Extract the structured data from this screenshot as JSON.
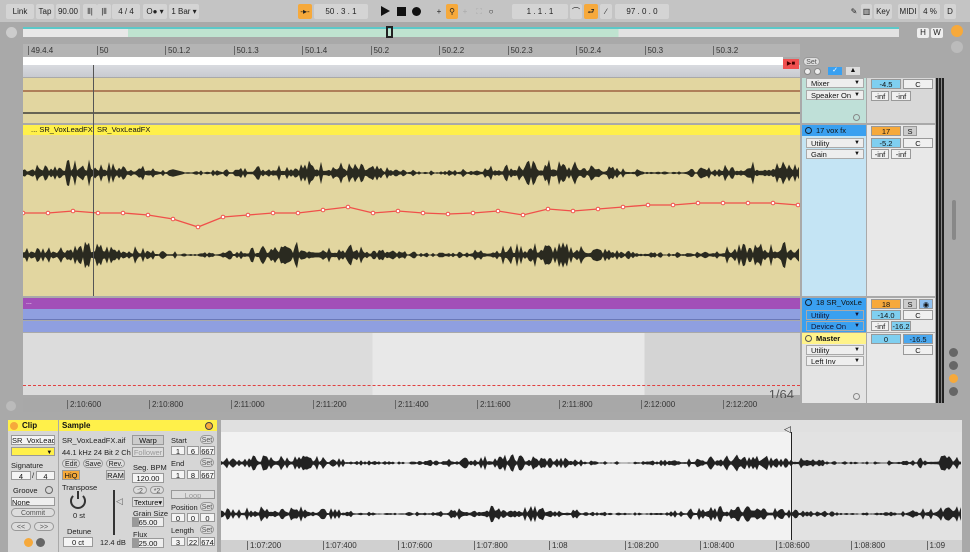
{
  "toolbar": {
    "link": "Link",
    "tap": "Tap",
    "tempo": "90.00",
    "nudge_down": "⦀|",
    "nudge_up": "|⦀",
    "sig_num": "4",
    "sig_sep": "/",
    "sig_den": "4",
    "metronome": "O●",
    "quantize": "1 Bar",
    "position": "50 .  3 .  1",
    "loop_start": "1 .  1 .  1",
    "loop_length": "97 .  0 .  0",
    "key": "Key",
    "midi": "MIDI",
    "cpu": "4 %",
    "d": "D"
  },
  "overview": {
    "h": "H",
    "w": "W"
  },
  "ruler": {
    "labels": [
      "49.4.4",
      "50",
      "50.1.2",
      "50.1.3",
      "50.1.4",
      "50.2",
      "50.2.2",
      "50.2.3",
      "50.2.4",
      "50.3",
      "50.3.2"
    ],
    "set": "Set"
  },
  "tracks": {
    "t1": {
      "device": "Mixer",
      "device2": "Speaker On",
      "vol": "-4.5",
      "pan": "C",
      "peak_l": "-inf",
      "peak_r": "-inf"
    },
    "t17": {
      "name": "17 vox fx",
      "clip_prev": "... SR_VoxLeadFX",
      "clip": "SR_VoxLeadFX",
      "num": "17",
      "solo": "S",
      "dev1": "Utility",
      "dev2": "Gain",
      "vol": "-5.2",
      "pan": "C",
      "peak_l": "-inf",
      "peak_r": "-inf"
    },
    "t18": {
      "name": "18 SR_VoxLe",
      "clip": "...",
      "num": "18",
      "solo": "S",
      "dev1": "Utility",
      "dev2": "Device On",
      "vol": "-14.0",
      "pan": "C",
      "peak_l": "-inf",
      "peak_r": "-16.2"
    },
    "master": {
      "name": "Master",
      "dev1": "Utility",
      "dev2": "Left Inv",
      "vol": "0",
      "vol2": "-16.5",
      "pan": "C",
      "zoom": "1/64"
    }
  },
  "time_ruler": [
    "2:10:600",
    "2:10:800",
    "2:11:000",
    "2:11:200",
    "2:11:400",
    "2:11:600",
    "2:11:800",
    "2:12:000",
    "2:12:200"
  ],
  "clip": {
    "title": "Clip",
    "name": "SR_VoxLeadF",
    "signature_lbl": "Signature",
    "sig_num": "4",
    "sig_den": "4",
    "groove_lbl": "Groove",
    "groove": "None",
    "commit": "Commit",
    "prev": "<<",
    "next": ">>"
  },
  "sample": {
    "title": "Sample",
    "file": "SR_VoxLeadFX.aif",
    "info": "44.1 kHz 24 Bit 2 Ch",
    "edit": "Edit",
    "save": "Save",
    "rev": "Rev.",
    "hiq": "HiQ",
    "ram": "RAM",
    "transpose_lbl": "Transpose",
    "transpose": "0 st",
    "detune_lbl": "Detune",
    "detune": "0 ct",
    "gain": "12.4 dB",
    "warp": "Warp",
    "follower": "Follower",
    "segbpm_lbl": "Seg. BPM",
    "segbpm": "120.00",
    "half": ":2",
    "dbl": "*2",
    "mode": "Texture",
    "grain_lbl": "Grain Size",
    "grain": "65.00",
    "flux_lbl": "Flux",
    "flux": "25.00",
    "start_lbl": "Start",
    "start": [
      "1",
      "6",
      "667"
    ],
    "end_lbl": "End",
    "end": [
      "1",
      "8",
      "667"
    ],
    "loop": "Loop",
    "position_lbl": "Position",
    "position": [
      "0",
      "0",
      "0"
    ],
    "length_lbl": "Length",
    "length": [
      "3",
      "22",
      "674"
    ],
    "set": "Set"
  },
  "sample_ruler": [
    "1:07:200",
    "1:07:400",
    "1:07:600",
    "1:07:800",
    "1:08",
    "1:08:200",
    "1:08:400",
    "1:08:600",
    "1:08:800",
    "1:09"
  ],
  "colors": {
    "accent": "#f6a93b",
    "clip_yellow": "#fff04a",
    "track_tan": "#e0d49c",
    "purple": "#a24fb8",
    "blue": "#8f9fe0",
    "sel_blue": "#3aa0f0",
    "auto_red": "#f0504a"
  }
}
